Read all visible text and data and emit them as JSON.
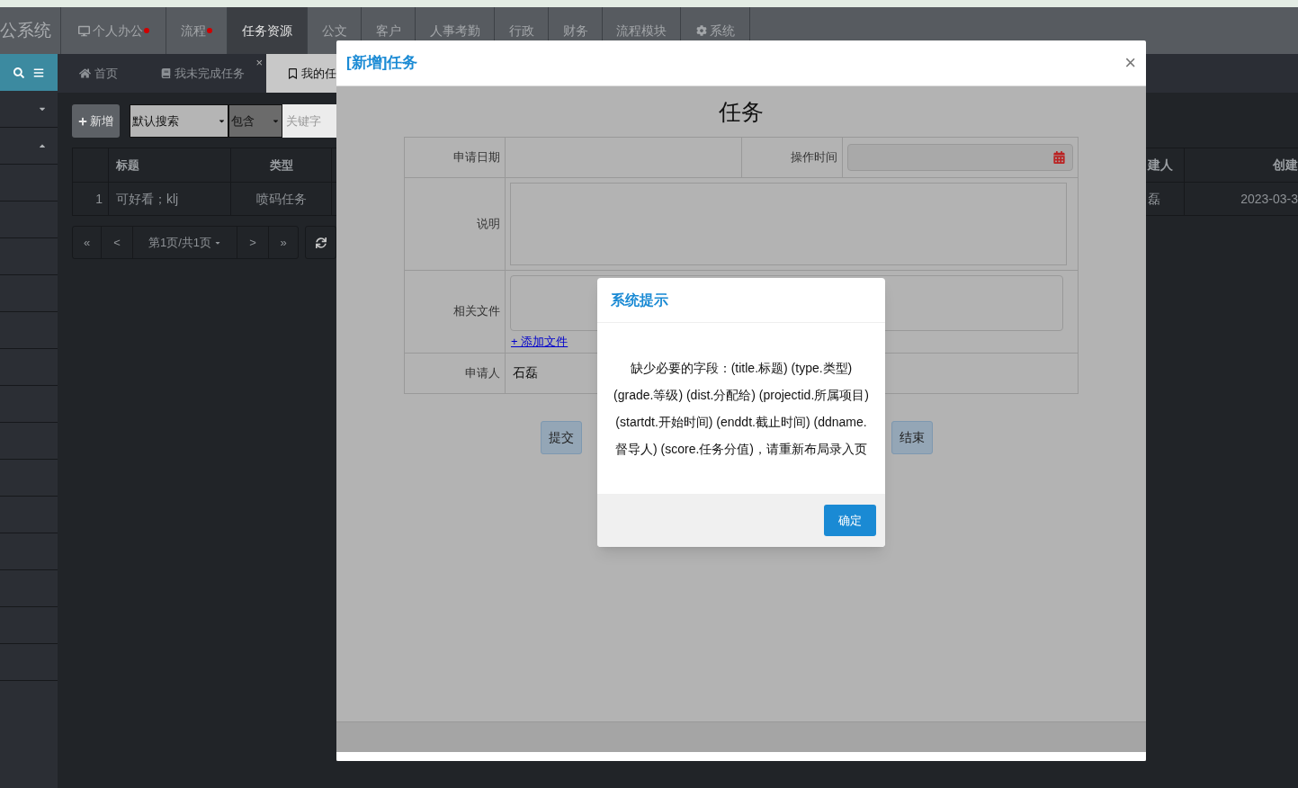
{
  "top_nav": {
    "brand": "公系统",
    "items": [
      {
        "label": "个人办公",
        "selected": false,
        "kind": "office",
        "notify": true
      },
      {
        "label": "流程",
        "selected": false,
        "kind": "plain",
        "notify": true
      },
      {
        "label": "任务资源",
        "selected": true,
        "kind": "plain",
        "notify": false
      },
      {
        "label": "公文",
        "selected": false,
        "kind": "plain",
        "notify": false
      },
      {
        "label": "客户",
        "selected": false,
        "kind": "plain",
        "notify": false
      },
      {
        "label": "人事考勤",
        "selected": false,
        "kind": "plain",
        "notify": false
      },
      {
        "label": "行政",
        "selected": false,
        "kind": "plain",
        "notify": false
      },
      {
        "label": "财务",
        "selected": false,
        "kind": "plain",
        "notify": false
      },
      {
        "label": "流程模块",
        "selected": false,
        "kind": "plain",
        "notify": false
      },
      {
        "label": "系统",
        "selected": false,
        "kind": "settings",
        "notify": false
      }
    ]
  },
  "sidebar": {
    "rows": [
      {
        "expanded": false
      },
      {
        "expanded": true
      }
    ]
  },
  "tabs": [
    {
      "label": "首页",
      "selected": false,
      "kind": "home"
    },
    {
      "label": "我未完成任务",
      "selected": false,
      "kind": "book",
      "close": "×"
    },
    {
      "label": "我的任",
      "selected": true,
      "kind": "bookmark"
    }
  ],
  "toolbar": {
    "add_button": "新增",
    "scope": "默认搜索",
    "match": "包含",
    "keyword_placeholder": "关键字"
  },
  "table": {
    "columns": [
      "标题",
      "类型"
    ],
    "rows": [
      {
        "index": "1",
        "title": "可好看；klj",
        "type": "喷码任务"
      }
    ],
    "right_columns": [
      "建人",
      "创建"
    ],
    "right_rows": [
      [
        "磊",
        "2023-03-3"
      ]
    ]
  },
  "pager": {
    "first": "«",
    "prev": "<",
    "page": "第1页/共1页",
    "next": ">",
    "last": "»"
  },
  "modal": {
    "title": "[新增]任务",
    "close": "×",
    "form_title": "任务",
    "labels": {
      "apply_date": "申请日期",
      "op_time": "操作时间",
      "description": "说明",
      "files": "相关文件",
      "applicant": "申请人"
    },
    "add_file": "+ 添加文件",
    "applicant": "石磊",
    "buttons": [
      "提交",
      "结束"
    ]
  },
  "alert": {
    "title": "系统提示",
    "message": "缺少必要的字段：(title.标题) (type.类型) (grade.等级) (dist.分配给) (projectid.所属项目) (startdt.开始时间) (enddt.截止时间) (ddname.督导人) (score.任务分值)，请重新布局录入页",
    "ok": "确定"
  }
}
